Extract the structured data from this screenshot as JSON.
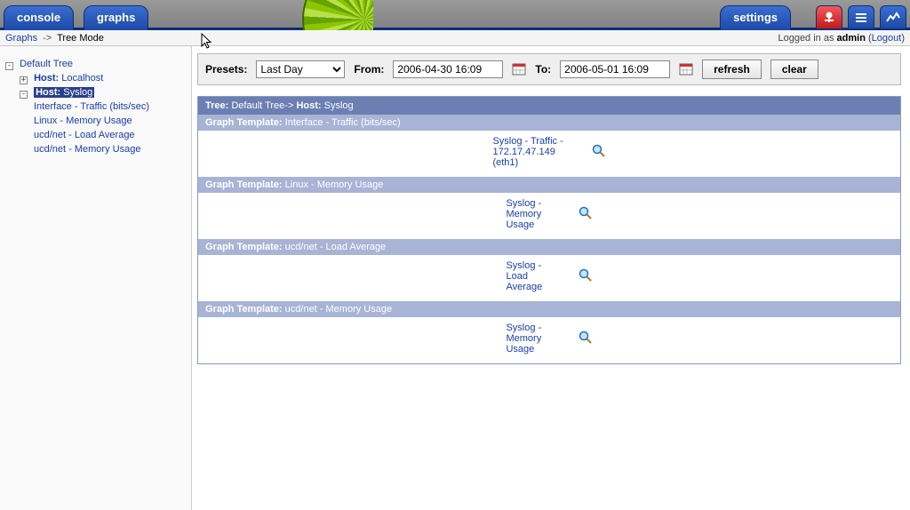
{
  "tabs": {
    "console": "console",
    "graphs": "graphs",
    "settings": "settings"
  },
  "breadcrumb": {
    "root": "Graphs",
    "sep": "->",
    "leaf": "Tree Mode"
  },
  "login": {
    "prefix": "Logged in as ",
    "user": "admin",
    "logout": "Logout"
  },
  "tree": {
    "root": "Default Tree",
    "host1_prefix": "Host:",
    "host1_name": "Localhost",
    "host2_prefix": "Host:",
    "host2_name": "Syslog",
    "leaf1": "Interface - Traffic (bits/sec)",
    "leaf2": "Linux - Memory Usage",
    "leaf3": "ucd/net - Load Average",
    "leaf4": "ucd/net - Memory Usage"
  },
  "filter": {
    "presets_label": "Presets:",
    "preset_value": "Last Day",
    "from_label": "From:",
    "from_value": "2006-04-30 16:09",
    "to_label": "To:",
    "to_value": "2006-05-01 16:09",
    "refresh": "refresh",
    "clear": "clear"
  },
  "results": {
    "tree_label": "Tree:",
    "tree_path": "Default Tree->",
    "host_label": "Host:",
    "host_name": "Syslog",
    "tpl_label": "Graph Template:",
    "tpl1": "Interface - Traffic (bits/sec)",
    "g1": "Syslog - Traffic - 172.17.47.149 (eth1)",
    "tpl2": "Linux - Memory Usage",
    "g2": "Syslog - Memory Usage",
    "tpl3": "ucd/net - Load Average",
    "g3": "Syslog - Load Average",
    "tpl4": "ucd/net - Memory Usage",
    "g4": "Syslog - Memory Usage"
  }
}
